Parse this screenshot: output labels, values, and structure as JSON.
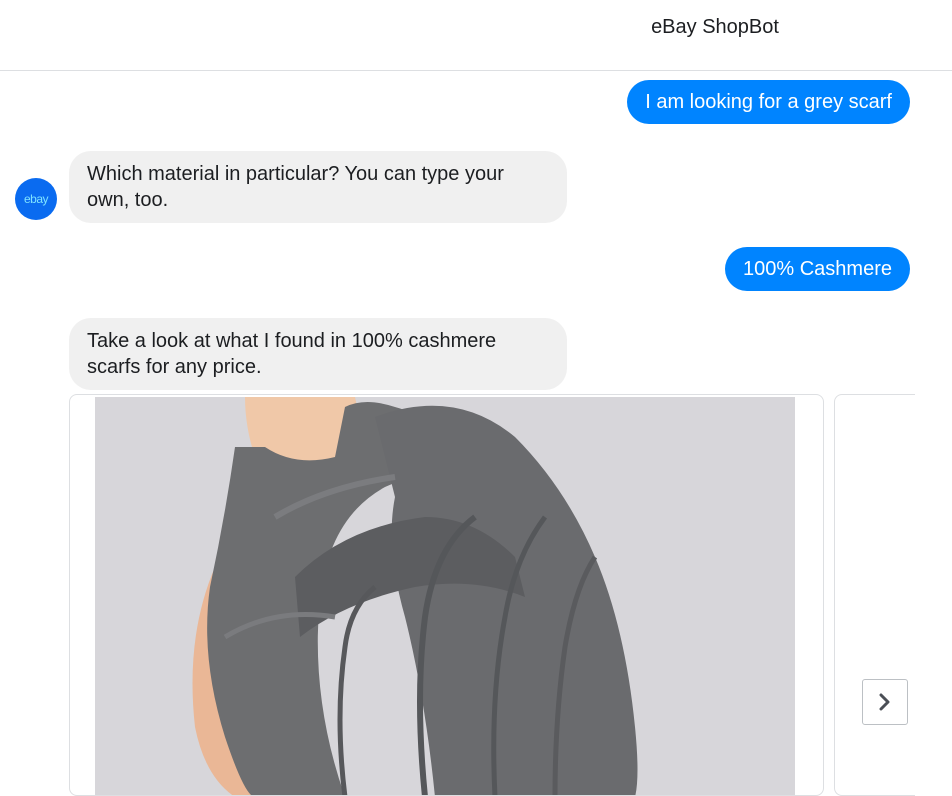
{
  "header": {
    "title": "eBay ShopBot"
  },
  "messages": [
    {
      "from": "user",
      "text": "I am looking for a grey scarf"
    },
    {
      "from": "bot",
      "text": "Which material in particular? You can type your own, too."
    },
    {
      "from": "user",
      "text": "100% Cashmere"
    },
    {
      "from": "bot",
      "text": "Take a look at what I found in 100% cashmere scarfs for any price."
    }
  ],
  "avatar": {
    "logo_text": "ebay",
    "color": "#0a6bf0"
  },
  "carousel": {
    "items": [
      {
        "image": "grey-cashmere-scarf-on-mannequin"
      }
    ],
    "next_icon": "chevron-right-icon"
  },
  "colors": {
    "outgoing_bubble": "#0084ff",
    "incoming_bubble": "#f0f0f0"
  }
}
